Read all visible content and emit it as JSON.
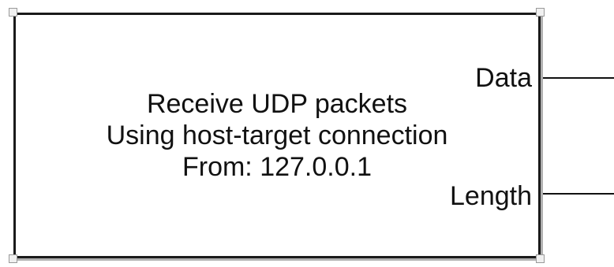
{
  "block": {
    "lines": [
      "Receive UDP packets",
      "Using host-target connection",
      "From: 127.0.0.1"
    ],
    "ports": {
      "data": "Data",
      "length": "Length"
    }
  }
}
